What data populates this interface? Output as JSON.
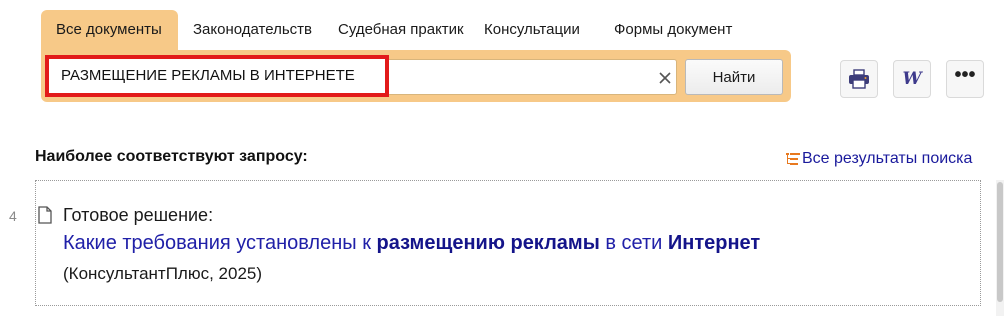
{
  "tabs": [
    {
      "label": "Все документы",
      "active": true
    },
    {
      "label": "Законодательств",
      "active": false
    },
    {
      "label": "Судебная практик",
      "active": false
    },
    {
      "label": "Консультации",
      "active": false
    },
    {
      "label": "Формы документ",
      "active": false
    }
  ],
  "search": {
    "query": "РАЗМЕЩЕНИЕ РЕКЛАМЫ В ИНТЕРНЕТЕ",
    "find_label": "Найти",
    "clear_icon": "close-icon"
  },
  "toolbar": {
    "print_icon": "printer-icon",
    "word_icon": "word-export-icon",
    "word_letter": "W",
    "more_icon": "more-dots-icon",
    "more_label": "•••"
  },
  "results": {
    "heading": "Наиболее соответствуют запросу:",
    "all_results_label": "Все результаты поиска",
    "items": [
      {
        "number": "4",
        "type_label": "Готовое решение:",
        "title_parts": {
          "p1": "Какие требования установлены к ",
          "b1": "размещению рекламы",
          "p2": " в сети ",
          "b2": "Интернет"
        },
        "source": "(КонсультантПлюс, 2025)"
      }
    ]
  },
  "colors": {
    "accent_tab": "#f7c988",
    "highlight_border": "#e21a1a",
    "link": "#2020a8"
  }
}
